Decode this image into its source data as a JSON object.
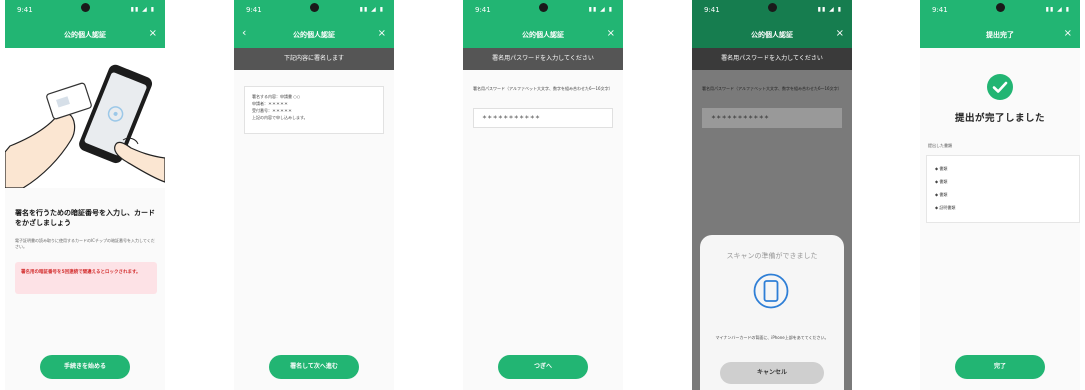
{
  "status": {
    "time": "9:41",
    "signal": "▮▮ ◢ ▮"
  },
  "screen1": {
    "nav_title": "公的個人認証",
    "close": "×",
    "heading": "署名を行うための暗証番号を入力し、カードをかざしましょう",
    "description": "電子証明書の読み取りに使用するカードのICチップの暗証番号を入力してください。",
    "warning": "署名用の暗証番号を5回連続で間違えるとロックされます。",
    "button": "手続きを始める"
  },
  "screen2": {
    "nav_title": "公的個人認証",
    "back": "‹",
    "close": "×",
    "subheader": "下記内容に署名します",
    "info_lines": [
      "署名する内容：申請書 ○○",
      "申請者：＊＊＊＊＊",
      "受付番号：＊＊＊＊＊",
      "",
      "上記の内容で申し込みします。"
    ],
    "button": "署名して次へ進む"
  },
  "screen3": {
    "nav_title": "公的個人認証",
    "close": "×",
    "subheader": "署名用パスワードを入力してください",
    "label": "署名用パスワード（アルファベット大文字、数字を組み合わせた6〜16文字）",
    "input_value": "＊＊＊＊＊＊＊＊＊＊＊",
    "button": "つぎへ"
  },
  "screen4": {
    "nav_title": "公的個人認証",
    "close": "×",
    "subheader": "署名用パスワードを入力してください",
    "label": "署名用パスワード（アルファベット大文字、数字を組み合わせた6〜16文字）",
    "input_value": "＊＊＊＊＊＊＊＊＊＊＊",
    "sheet_title": "スキャンの準備ができました",
    "sheet_caption": "マイナンバーカードの背面に、iPhone上部をあててください。",
    "cancel": "キャンセル"
  },
  "screen5": {
    "nav_title": "提出完了",
    "close": "×",
    "heading": "提出が完了しました",
    "section_label": "提出した書類",
    "items": [
      "◆ 書類",
      "◆ 書類",
      "◆ 書類",
      "◆ 証明書類"
    ],
    "button": "完了"
  },
  "colors": {
    "accent": "#22b573",
    "warning": "#d32f2f"
  }
}
